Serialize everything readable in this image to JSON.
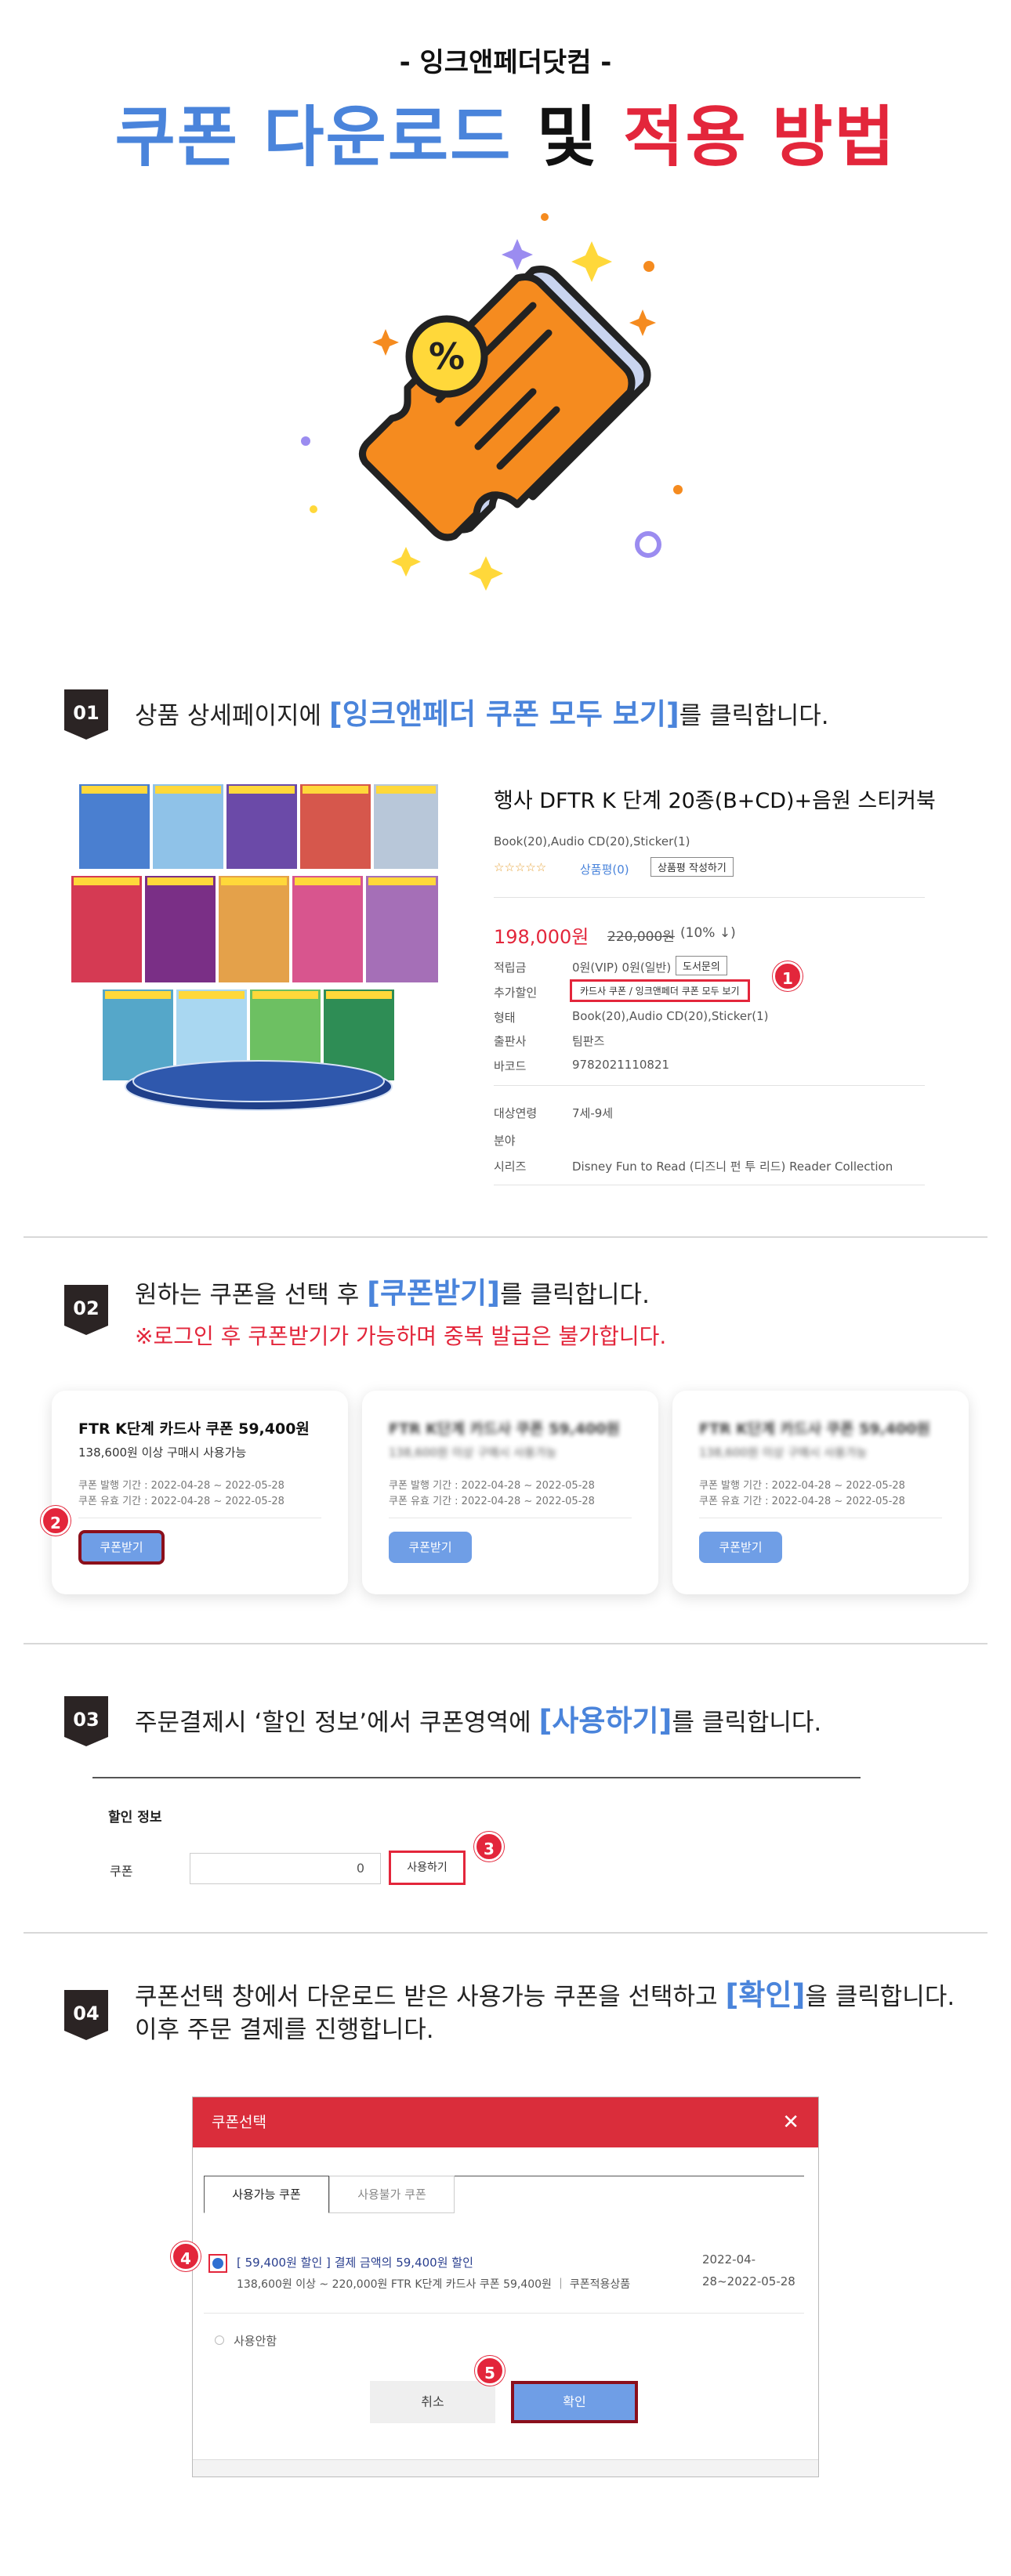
{
  "header": {
    "brand": "- 잉크앤페더닷컴 -",
    "title_part1": "쿠폰 다운로드",
    "title_part2": "및",
    "title_part3": "적용 방법"
  },
  "colors": {
    "blue": "#4a84db",
    "red": "#e3263b",
    "dark_badge": "#2b2424",
    "orange": "#f58b1f",
    "yellow": "#ffd83a"
  },
  "step1": {
    "badge": "01",
    "text_before": "상품 상세페이지에",
    "highlight": "[잉크앤페더 쿠폰 모두 보기]",
    "text_after": "를 클릭합니다.",
    "product": {
      "name": "행사 DFTR K 단계 20종(B+CD)+음원 스티커북",
      "spec": "Book(20),Audio CD(20),Sticker(1)",
      "review": "상품평(0)",
      "review_btn": "상품평 작성하기",
      "price": "198,000원",
      "original_price": "220,000원",
      "discount": "(10% ↓)",
      "rows": [
        {
          "label": "적립금",
          "value": "0원(VIP) 0원(일반)"
        },
        {
          "label": "추가할인",
          "value": "카드사 쿠폰 / 잉크앤페더 쿠폰 모두 보기"
        },
        {
          "label": "형태",
          "value": "Book(20),Audio CD(20),Sticker(1)"
        },
        {
          "label": "출판사",
          "value": "팀판즈"
        },
        {
          "label": "바코드",
          "value": "9782021110821"
        },
        {
          "label": "대상연령",
          "value": "7세-9세"
        },
        {
          "label": "분야",
          "value": ""
        },
        {
          "label": "시리즈",
          "value": "Disney Fun to Read (디즈니 펀 투 리드) Reader Collection"
        }
      ],
      "inquiry_btn": "도서문의"
    },
    "marker": "1"
  },
  "step2": {
    "badge": "02",
    "text_before": "원하는 쿠폰을 선택 후",
    "highlight": "[쿠폰받기]",
    "text_after": "를 클릭합니다.",
    "warning": "※로그인 후 쿠폰받기가 가능하며 중복 발급은 불가합니다.",
    "cards": [
      {
        "title": "FTR K단계 카드사 쿠폰 59,400원",
        "sub": "138,600원 이상 구매시 사용가능",
        "issue": "쿠폰 발행 기간 : 2022-04-28 ~ 2022-05-28",
        "valid": "쿠폰 유효 기간 : 2022-04-28 ~ 2022-05-28",
        "button": "쿠폰받기"
      },
      {
        "title": "FTR K단계 카드사 쿠폰 59,400원",
        "sub": "138,600원 이상 구매시 사용가능",
        "issue": "쿠폰 발행 기간 : 2022-04-28 ~ 2022-05-28",
        "valid": "쿠폰 유효 기간 : 2022-04-28 ~ 2022-05-28",
        "button": "쿠폰받기"
      },
      {
        "title": "FTR K단계 카드사 쿠폰 59,400원",
        "sub": "138,600원 이상 구매시 사용가능",
        "issue": "쿠폰 발행 기간 : 2022-04-28 ~ 2022-05-28",
        "valid": "쿠폰 유효 기간 : 2022-04-28 ~ 2022-05-28",
        "button": "쿠폰받기"
      }
    ],
    "marker": "2"
  },
  "step3": {
    "badge": "03",
    "text_before": "주문결제시 ‘할인 정보’에서 쿠폰영역에",
    "highlight": "[사용하기]",
    "text_after": "를 클릭합니다.",
    "section_title": "할인 정보",
    "coupon_label": "쿠폰",
    "coupon_value": "0",
    "use_button": "사용하기",
    "marker": "3"
  },
  "step4": {
    "badge": "04",
    "text_before": "쿠폰선택 창에서 다운로드 받은 사용가능 쿠폰을 선택하고",
    "highlight": "[확인]",
    "text_after": "을 클릭합니다.",
    "text_line2": "이후 주문 결제를 진행합니다.",
    "modal": {
      "title": "쿠폰선택",
      "tabs": [
        "사용가능 쿠폰",
        "사용불가 쿠폰"
      ],
      "coupon_line1_prefix": "[ 59,400원 할인 ]",
      "coupon_line1_suffix": "결제 금액의 59,400원 할인",
      "coupon_line2": "138,600원 이상 ~ 220,000원 FTR K단계 카드사 쿠폰 59,400원 ｜ 쿠폰적용상품",
      "coupon_date1": "2022-04-",
      "coupon_date2": "28~2022-05-28",
      "no_use": "사용안함",
      "cancel": "취소",
      "confirm": "확인"
    },
    "markers": [
      "4",
      "5"
    ]
  }
}
